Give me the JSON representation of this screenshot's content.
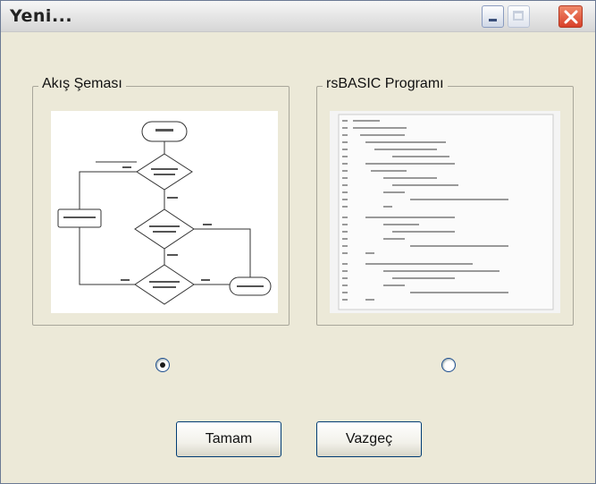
{
  "window": {
    "title": "Yeni..."
  },
  "options": [
    {
      "label": "Akış Şeması",
      "selected": true
    },
    {
      "label": "rsBASIC Programı",
      "selected": false
    }
  ],
  "buttons": {
    "ok": "Tamam",
    "cancel": "Vazgeç"
  },
  "colors": {
    "dialog_bg": "#ece9d8",
    "close_button": "#d8402a"
  },
  "icons": [
    "minimize-icon",
    "maximize-icon",
    "close-icon"
  ]
}
